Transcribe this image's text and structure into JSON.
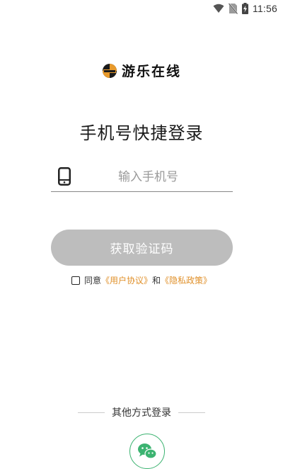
{
  "status_bar": {
    "time": "11:56",
    "icons": [
      "wifi-icon",
      "no-sim-icon",
      "battery-charging-icon"
    ]
  },
  "brand": {
    "logo_icon": "brand-logo-icon",
    "name": "游乐在线"
  },
  "page": {
    "title": "手机号快捷登录"
  },
  "phone": {
    "icon": "phone-icon",
    "value": "",
    "placeholder": "输入手机号"
  },
  "code_button": {
    "label": "获取验证码",
    "state": "disabled"
  },
  "agreement": {
    "checked": false,
    "prefix": "同意",
    "user_agreement": "《用户协议》",
    "conjunction": "和",
    "privacy_policy": "《隐私政策》"
  },
  "other_login": {
    "label": "其他方式登录",
    "wechat_icon": "wechat-icon"
  },
  "colors": {
    "link": "#e0902a",
    "button_disabled": "#bdbdbd",
    "wechat": "#3cb371"
  }
}
